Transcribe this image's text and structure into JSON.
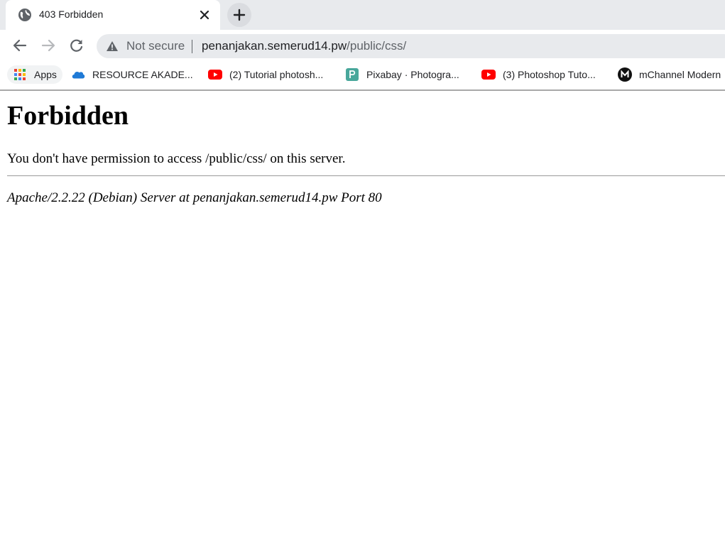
{
  "tab": {
    "title": "403 Forbidden",
    "favicon": "globe-icon"
  },
  "toolbar": {
    "security_label": "Not secure",
    "url_host": "penanjakan.semerud14.pw",
    "url_path": "/public/css/"
  },
  "bookmarks": [
    {
      "label": "Apps",
      "icon": "apps-grid-icon"
    },
    {
      "label": "RESOURCE AKADE...",
      "icon": "onedrive-cloud-icon"
    },
    {
      "label": "(2) Tutorial photosh...",
      "icon": "youtube-icon"
    },
    {
      "label": "Pixabay · Photogra...",
      "icon": "pixabay-icon"
    },
    {
      "label": "(3) Photoshop Tuto...",
      "icon": "youtube-icon"
    },
    {
      "label": "mChannel Modern",
      "icon": "mchannel-icon"
    }
  ],
  "page": {
    "heading": "Forbidden",
    "message": "You don't have permission to access /public/css/ on this server.",
    "server_signature": "Apache/2.2.22 (Debian) Server at penanjakan.semerud14.pw Port 80"
  },
  "colors": {
    "tabstrip_bg": "#e8eaed",
    "omnibox_bg": "#e8eaed",
    "youtube_red": "#ff0000",
    "pixabay_green": "#48a79b",
    "onedrive_blue": "#1f7ad6"
  }
}
